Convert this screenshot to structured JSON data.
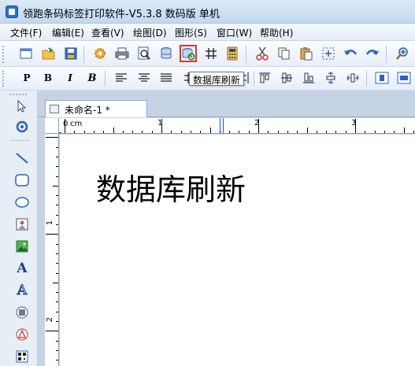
{
  "window": {
    "title": "领跑条码标签打印软件-V5.3.8 数码版 单机"
  },
  "menu": {
    "items": [
      {
        "label": "文件(F)"
      },
      {
        "label": "编辑(E)"
      },
      {
        "label": "查看(V)"
      },
      {
        "label": "绘图(D)"
      },
      {
        "label": "图形(S)"
      },
      {
        "label": "窗口(W)"
      },
      {
        "label": "帮助(H)"
      }
    ]
  },
  "toolbar_format": {
    "plain": "P",
    "bold": "B",
    "italic": "I",
    "bold_italic": "B"
  },
  "tooltip": {
    "text": "数据库刷新"
  },
  "document": {
    "tab_label": "未命名-1 *",
    "ruler_unit": "cm",
    "h_ruler_numbers": [
      "0",
      "1",
      "2",
      "3"
    ],
    "v_ruler_numbers": [
      "1",
      "2"
    ],
    "canvas_text": "数据库刷新"
  },
  "left_tools": {
    "text_tool": "A",
    "text_tool_2": "A"
  },
  "colors": {
    "highlight_border": "#e53030",
    "titlebar": "#c2d8f0",
    "ruler_marker": "#1f56c4"
  }
}
